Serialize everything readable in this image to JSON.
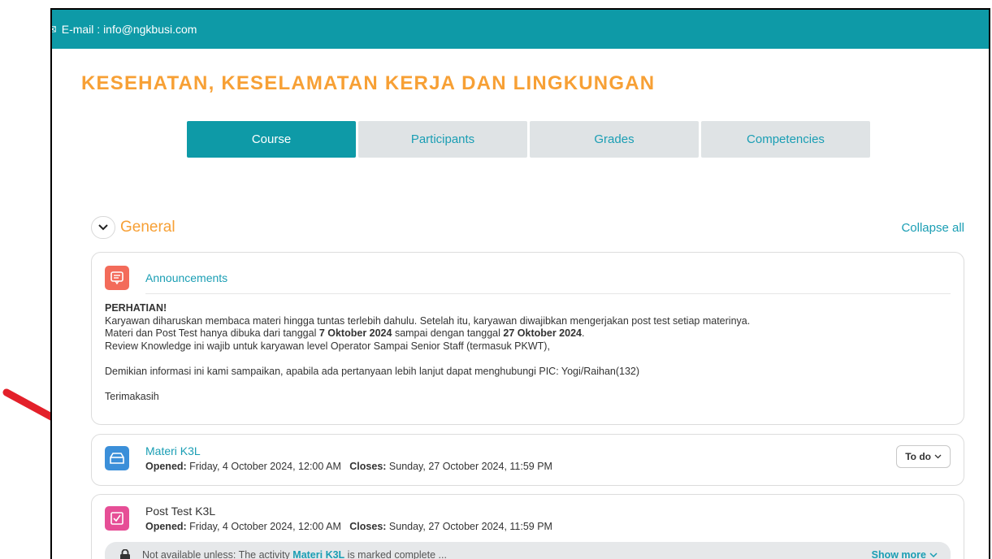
{
  "topbar": {
    "email": "E-mail : info@ngkbusi.com"
  },
  "course": {
    "title": "KESEHATAN, KESELAMATAN KERJA DAN LINGKUNGAN"
  },
  "tabs": [
    {
      "label": "Course",
      "active": true
    },
    {
      "label": "Participants",
      "active": false
    },
    {
      "label": "Grades",
      "active": false
    },
    {
      "label": "Competencies",
      "active": false
    }
  ],
  "section": {
    "name": "General",
    "collapse_all": "Collapse all"
  },
  "announcement": {
    "title": "Announcements",
    "heading": "PERHATIAN!",
    "line1": "Karyawan diharuskan membaca materi hingga tuntas terlebih dahulu. Setelah itu, karyawan diwajibkan mengerjakan post test setiap materinya.",
    "line2_pre": "Materi dan Post Test hanya dibuka dari tanggal ",
    "line2_date1": "7 Oktober 2024",
    "line2_mid": " sampai dengan tanggal ",
    "line2_date2": "27 Oktober 2024",
    "line2_end": ".",
    "line3": "Review Knowledge ini wajib untuk karyawan level Operator Sampai Senior Staff (termasuk PKWT),",
    "line4": "Demikian informasi ini kami sampaikan, apabila ada pertanyaan lebih lanjut dapat menghubungi PIC: Yogi/Raihan(132)",
    "line5": "Terimakasih"
  },
  "materi": {
    "title": "Materi K3L",
    "opened_label": "Opened:",
    "opened_value": " Friday, 4 October 2024, 12:00 AM",
    "closes_label": "Closes:",
    "closes_value": " Sunday, 27 October 2024, 11:59 PM",
    "todo_label": "To do"
  },
  "post_test": {
    "title": "Post Test K3L",
    "opened_label": "Opened:",
    "opened_value": " Friday, 4 October 2024, 12:00 AM",
    "closes_label": "Closes:",
    "closes_value": " Sunday, 27 October 2024, 11:59 PM",
    "restriction_pre": "Not available unless: The activity ",
    "restriction_link": "Materi K3L",
    "restriction_post": " is marked complete ...",
    "show_more": "Show more"
  },
  "colors": {
    "teal": "#0e9aa7",
    "orange": "#f7a035",
    "link": "#1a9eb4",
    "annotation_arrow": "#e3202a"
  }
}
